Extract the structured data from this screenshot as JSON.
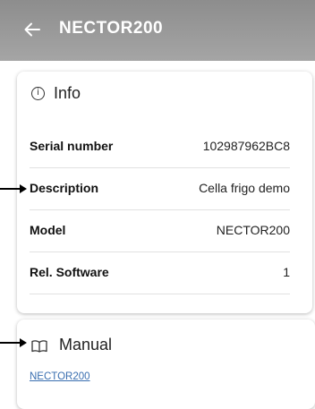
{
  "header": {
    "title": "NECTOR200",
    "back_icon": "arrow-left-icon"
  },
  "info_card": {
    "icon": "info-circle-icon",
    "title": "Info",
    "rows": [
      {
        "label": "Serial number",
        "value": "102987962BC8"
      },
      {
        "label": "Description",
        "value": "Cella frigo demo"
      },
      {
        "label": "Model",
        "value": "NECTOR200"
      },
      {
        "label": "Rel. Software",
        "value": "1"
      }
    ]
  },
  "manual_card": {
    "icon": "book-open-icon",
    "title": "Manual",
    "link_text": "NECTOR200"
  },
  "annotations": {
    "arrow_color": "#000000"
  },
  "colors": {
    "appbar": "#999999",
    "link": "#3a6fb0"
  }
}
